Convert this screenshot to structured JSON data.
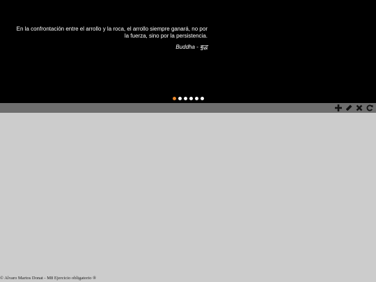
{
  "slider": {
    "quote": "En la confrontación entre el arrollo y la roca, el arrollo siempre ganará, no por la fuerza, sino por la persistencia.",
    "author": "Buddha - बुद्ध",
    "dots": [
      {
        "state": "active"
      },
      {
        "state": "inactive"
      },
      {
        "state": "inactive"
      },
      {
        "state": "inactive"
      },
      {
        "state": "inactive"
      },
      {
        "state": "inactive"
      }
    ]
  },
  "toolbar": {
    "icons": [
      "plus-icon",
      "pencil-icon",
      "close-icon",
      "refresh-icon"
    ]
  },
  "footer": {
    "text": "© Alvaro Martos Donat - M8 Ejercicio obligatorio ®"
  },
  "colors": {
    "slider_bg": "#000000",
    "active_dot": "#e8862a",
    "inactive_dot": "#ffffff",
    "toolbar_bg": "#6e6e6e",
    "page_bg": "#cccccc"
  }
}
